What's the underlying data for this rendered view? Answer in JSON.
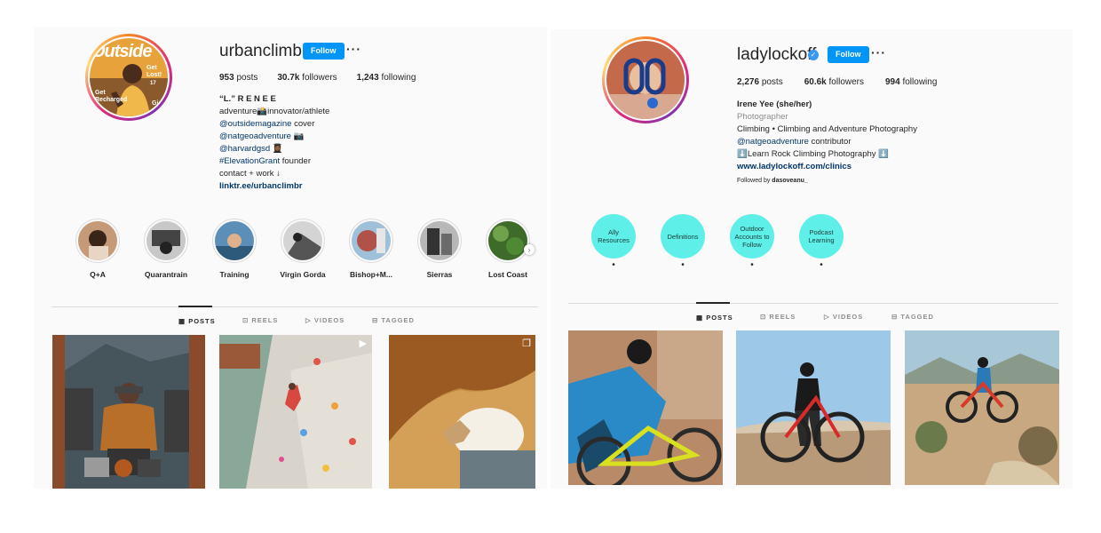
{
  "left": {
    "avatar": {
      "magazine_title": "Outside",
      "cover_lines": [
        "Get Lost!",
        "Get Recharged",
        "Gi",
        "SI"
      ],
      "cover_number": "17"
    },
    "username": "urbanclimbr",
    "follow_label": "Follow",
    "more_label": "···",
    "stats": [
      {
        "value": "953",
        "label": "posts"
      },
      {
        "value": "30.7k",
        "label": "followers"
      },
      {
        "value": "1,243",
        "label": "following"
      }
    ],
    "bio": {
      "name": "“L.” R E N E E",
      "line1": "adventure📸innovator/athlete",
      "line2_link": "@outsidemagazine",
      "line2_text": " cover",
      "line3_link": "@natgeoadventure",
      "line3_text": " 📷",
      "line4_link": "@harvardgsd",
      "line4_text": " 👩🏾‍🎓",
      "line5_link": "#ElevationGrant",
      "line5_text": " founder",
      "line6": "contact + work ↓",
      "website": "linktr.ee/urbanclimbr"
    },
    "highlights": [
      {
        "label": "Q+A"
      },
      {
        "label": "Quarantrain"
      },
      {
        "label": "Training"
      },
      {
        "label": "Virgin Gorda"
      },
      {
        "label": "Bishop+M..."
      },
      {
        "label": "Sierras"
      },
      {
        "label": "Lost Coast"
      }
    ],
    "highlights_next_arrow": "›",
    "tabs": [
      "POSTS",
      "REELS",
      "VIDEOS",
      "TAGGED"
    ]
  },
  "right": {
    "username": "ladylockoff",
    "verified_icon": "✓",
    "follow_label": "Follow",
    "more_label": "···",
    "stats": [
      {
        "value": "2,276",
        "label": "posts"
      },
      {
        "value": "60.6k",
        "label": "followers"
      },
      {
        "value": "994",
        "label": "following"
      }
    ],
    "bio": {
      "name": "Irene Yee (she/her)",
      "category": "Photographer",
      "line1": "Climbing • Climbing and Adventure Photography",
      "line2_link": "@natgeoadventure",
      "line2_text": " contributor",
      "line3": "⬇️Learn Rock Climbing Photography ⬇️",
      "website": "www.ladylockoff.com/clinics",
      "followed_by_prefix": "Followed by ",
      "followed_by_user": "dasoveanu_"
    },
    "highlights": [
      {
        "label": "Ally Resources",
        "dot": "•"
      },
      {
        "label": "Definitions",
        "dot": "•"
      },
      {
        "label": "Outdoor Accounts to Follow",
        "dot": "•"
      },
      {
        "label": "Podcast Learning",
        "dot": "•"
      }
    ],
    "tabs": [
      "POSTS",
      "REELS",
      "VIDEOS",
      "TAGGED"
    ]
  },
  "icons": {
    "grid": "▦",
    "reels": "⊡",
    "videos": "▷",
    "tagged": "⊟",
    "multi": "❐",
    "reel": "▶"
  }
}
